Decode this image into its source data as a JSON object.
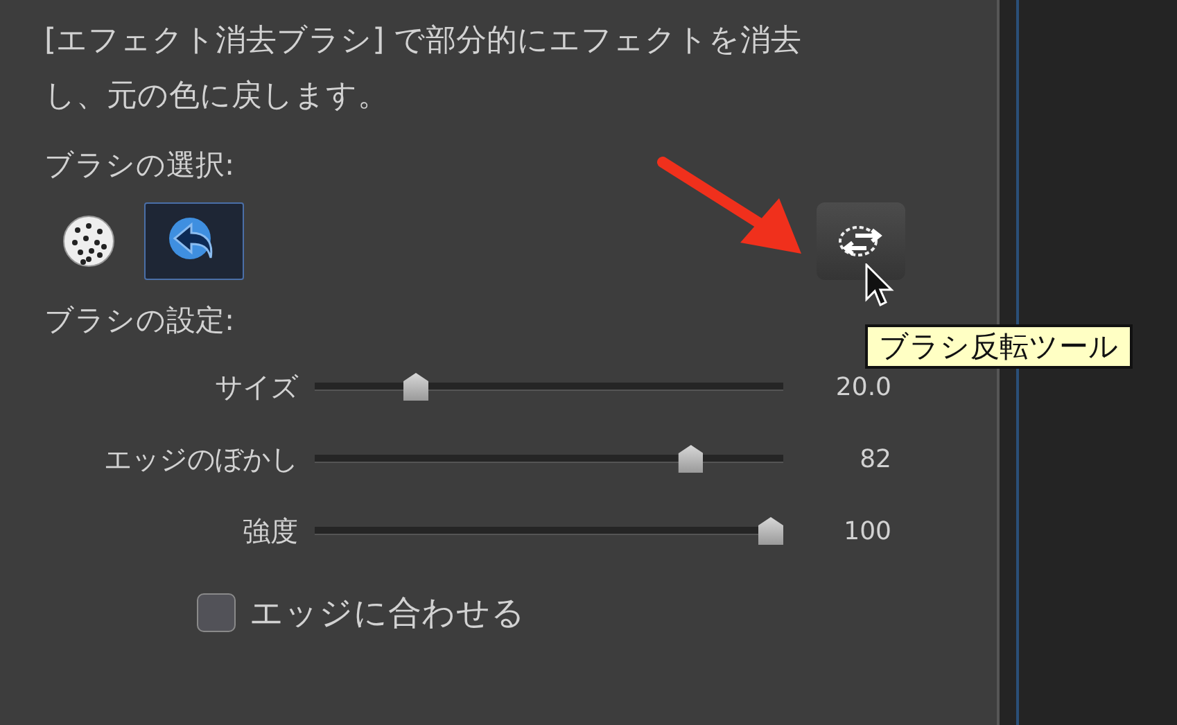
{
  "description": "[エフェクト消去ブラシ] で部分的にエフェクトを消去し、元の色に戻します。",
  "brush_section": {
    "label": "ブラシの選択:",
    "brushes": [
      {
        "kind": "dotted",
        "selected": false
      },
      {
        "kind": "erase",
        "selected": true
      }
    ],
    "invert_button": {
      "tooltip": "ブラシ反転ツール"
    }
  },
  "settings_section": {
    "label": "ブラシの設定:",
    "sliders": [
      {
        "label": "サイズ",
        "level": 0.2,
        "reading": "20.0"
      },
      {
        "label": "エッジのぼかし",
        "level": 0.82,
        "reading": "82"
      },
      {
        "label": "強度",
        "level": 1,
        "reading": "100"
      }
    ],
    "checkbox": {
      "label": "エッジに合わせる",
      "checked": false
    }
  }
}
